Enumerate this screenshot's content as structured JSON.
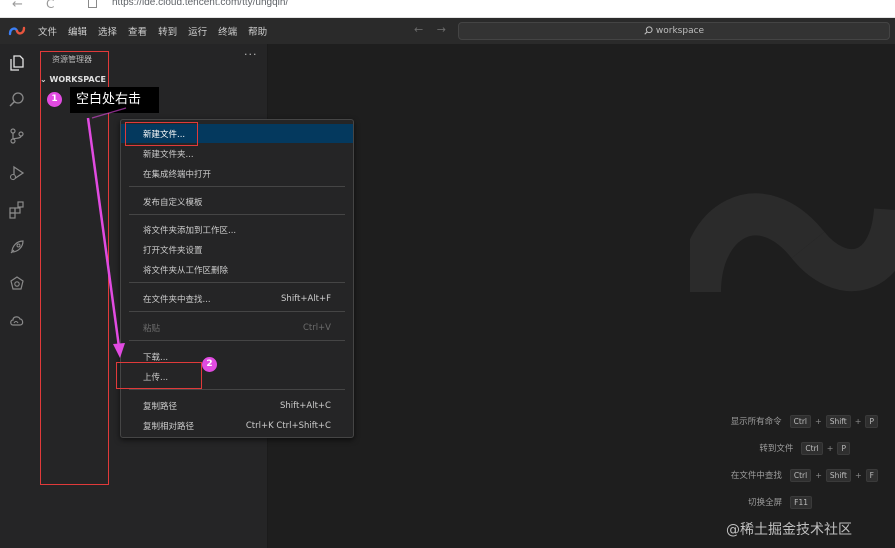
{
  "browser": {
    "back_glyph": "←",
    "reload_glyph": "C",
    "url": "https://ide.cloud.tencent.com/tty/uhgqih/"
  },
  "titlebar": {
    "menu": [
      "文件",
      "编辑",
      "选择",
      "查看",
      "转到",
      "运行",
      "终端",
      "帮助"
    ],
    "nav_back": "←",
    "nav_forward": "→",
    "search_text": "workspace"
  },
  "sidebar": {
    "title": "资源管理器",
    "more": "···",
    "workspace_label": "WORKSPACE"
  },
  "callouts": {
    "step1_number": "1",
    "step1_text": "空白处右击",
    "step2_number": "2"
  },
  "context_menu": {
    "items": [
      {
        "label": "新建文件...",
        "shortcut": ""
      },
      {
        "label": "新建文件夹...",
        "shortcut": ""
      },
      {
        "label": "在集成终端中打开",
        "shortcut": ""
      },
      {
        "label": "发布自定义模板",
        "shortcut": ""
      },
      {
        "label": "将文件夹添加到工作区...",
        "shortcut": ""
      },
      {
        "label": "打开文件夹设置",
        "shortcut": ""
      },
      {
        "label": "将文件夹从工作区删除",
        "shortcut": ""
      },
      {
        "label": "在文件夹中查找...",
        "shortcut": "Shift+Alt+F"
      },
      {
        "label": "粘贴",
        "shortcut": "Ctrl+V"
      },
      {
        "label": "下载...",
        "shortcut": ""
      },
      {
        "label": "上传...",
        "shortcut": ""
      },
      {
        "label": "复制路径",
        "shortcut": "Shift+Alt+C"
      },
      {
        "label": "复制相对路径",
        "shortcut": "Ctrl+K Ctrl+Shift+C"
      }
    ]
  },
  "shortcuts": [
    {
      "label": "显示所有命令",
      "keys": [
        "Ctrl",
        "Shift",
        "P"
      ]
    },
    {
      "label": "转到文件",
      "keys": [
        "Ctrl",
        "P"
      ]
    },
    {
      "label": "在文件中查找",
      "keys": [
        "Ctrl",
        "Shift",
        "F"
      ]
    },
    {
      "label": "切换全屏",
      "keys": [
        "F11"
      ]
    }
  ],
  "watermark": "@稀土掘金技术社区",
  "colors": {
    "accent_magenta": "#e14be1",
    "highlight_red": "#e03a3a",
    "active_item": "#04395e"
  }
}
